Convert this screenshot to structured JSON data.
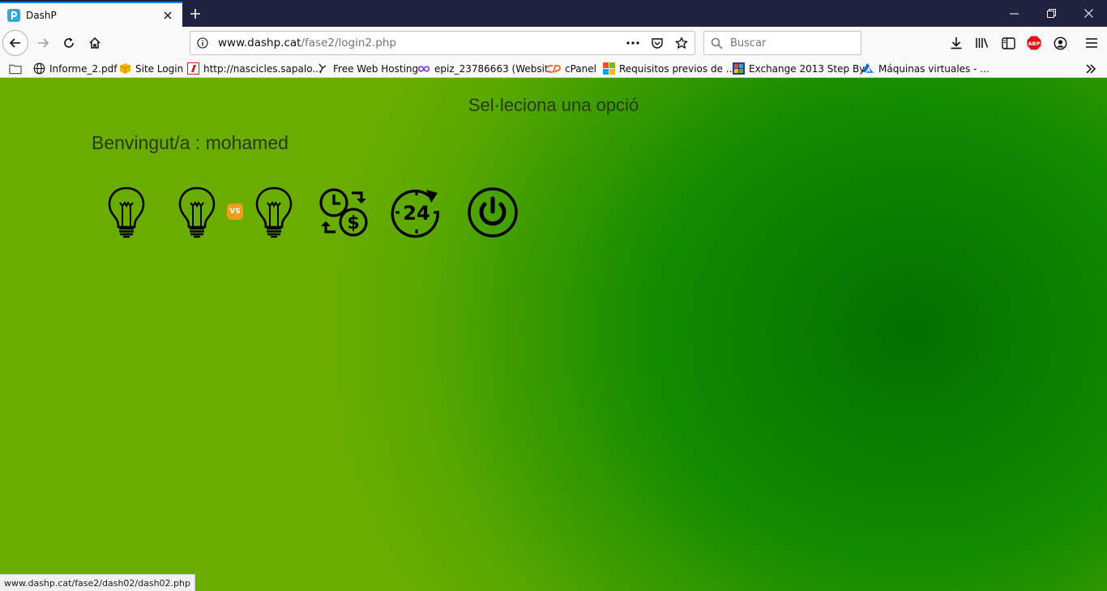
{
  "browser": {
    "tab": {
      "title": "DashP"
    },
    "url": {
      "domain": "www.dashp.cat",
      "path": "/fase2/login2.php"
    },
    "search": {
      "placeholder": "Buscar"
    },
    "bookmarks": [
      {
        "label": "Informe_2.pdf",
        "icon": "globe-icon"
      },
      {
        "label": "Site Login",
        "icon": "box-icon"
      },
      {
        "label": "http://nascicles.sapalo...",
        "icon": "red-favicon-icon"
      },
      {
        "label": "Free Web Hosting",
        "icon": "bird-icon"
      },
      {
        "label": "epiz_23786663 (Websit...",
        "icon": "infinity-icon"
      },
      {
        "label": "cPanel",
        "icon": "cpanel-icon"
      },
      {
        "label": "Requisitos previos de ...",
        "icon": "windows-icon"
      },
      {
        "label": "Exchange 2013 Step By...",
        "icon": "exchange-icon"
      },
      {
        "label": "Máquinas virtuales - ...",
        "icon": "azure-icon"
      }
    ],
    "status_url": "www.dashp.cat/fase2/dash02/dash02.php",
    "abp_label": "ABP"
  },
  "page": {
    "heading": "Sel·leciona una opció",
    "welcome": "Benvingut/a : mohamed",
    "vs_label": "VS",
    "timer_label": "24",
    "options": [
      {
        "name": "bulb-option",
        "icon": "lightbulb-icon"
      },
      {
        "name": "compare-option",
        "icon": "lightbulb-vs-icon"
      },
      {
        "name": "cost-option",
        "icon": "clock-money-icon"
      },
      {
        "name": "24h-option",
        "icon": "24-hours-icon"
      },
      {
        "name": "logout-option",
        "icon": "power-icon"
      }
    ]
  }
}
